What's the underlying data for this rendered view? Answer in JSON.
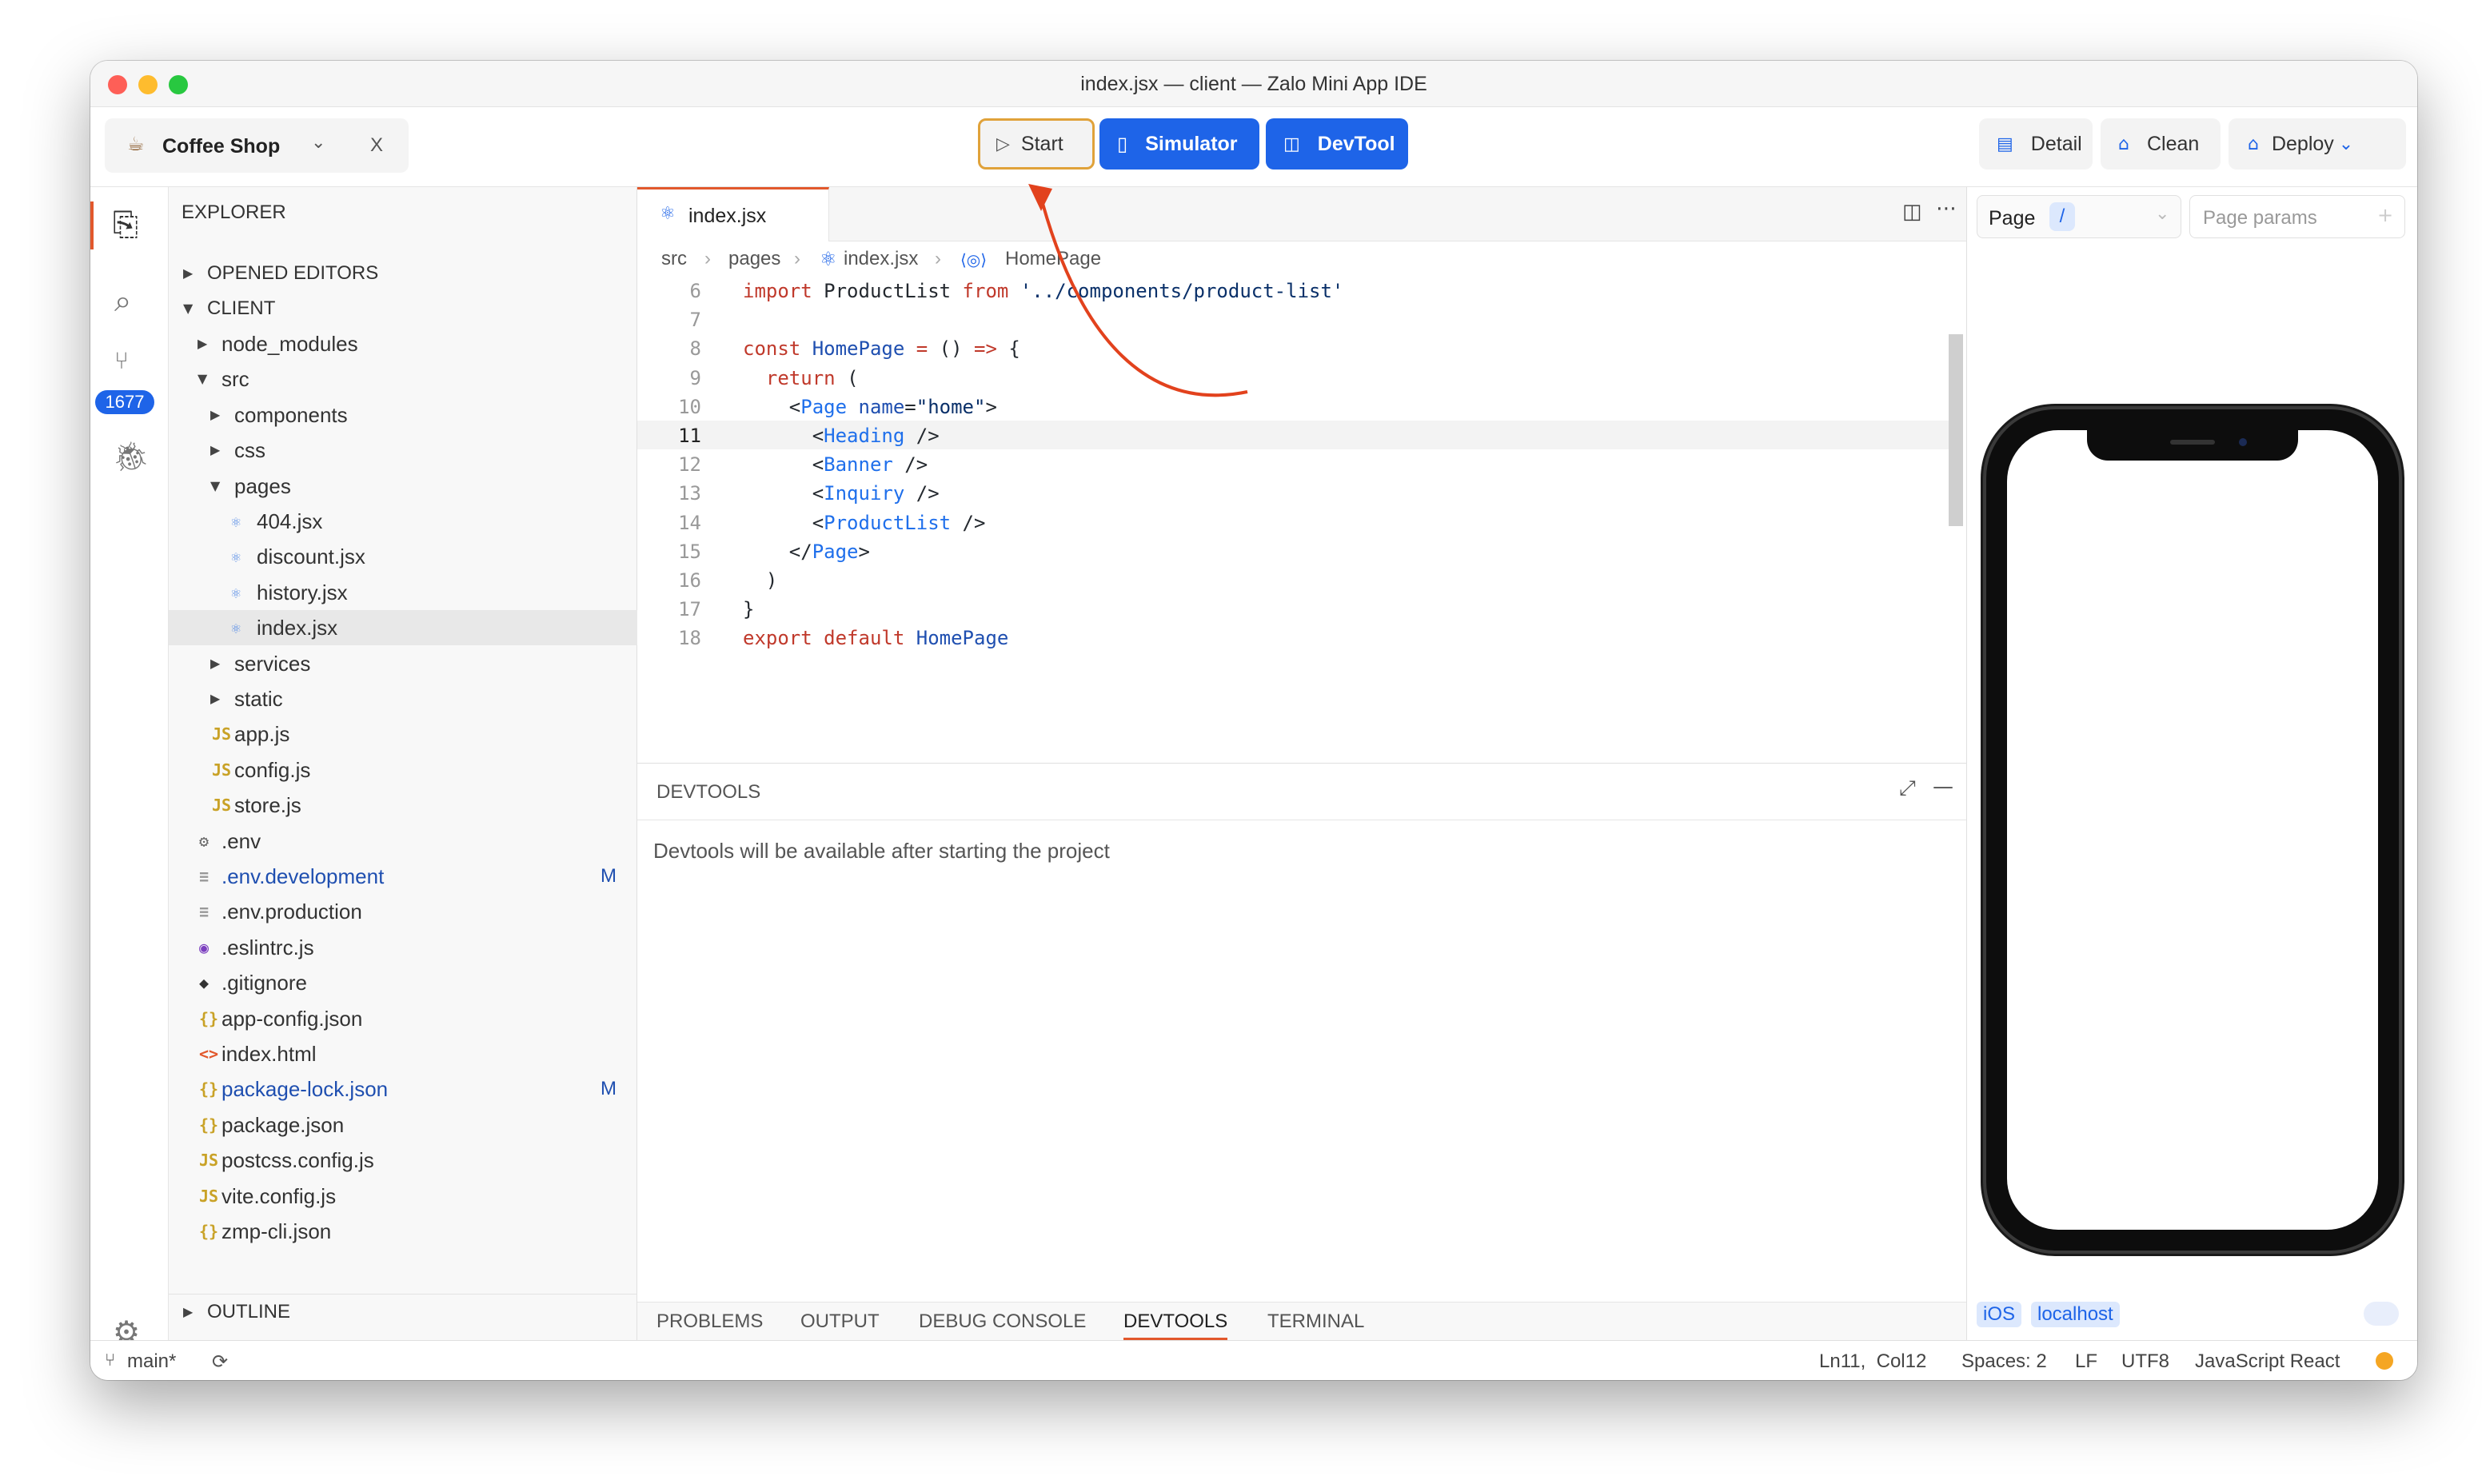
{
  "window": {
    "title": "index.jsx — client — Zalo Mini App IDE",
    "traffic_lights": {
      "close": "#fe5f57",
      "minimize": "#febc2e",
      "zoom": "#28c840"
    }
  },
  "toolbar": {
    "project_name": "Coffee Shop",
    "close_label": "X",
    "start_label": "Start",
    "simulator_label": "Simulator",
    "devtool_label": "DevTool",
    "detail_label": "Detail",
    "clean_label": "Clean",
    "deploy_label": "Deploy",
    "accent_color": "#1e64e8",
    "start_highlight_color": "#e0a23a"
  },
  "activity_bar": {
    "source_control_badge": "1677"
  },
  "explorer": {
    "title": "EXPLORER",
    "opened_editors": "OPENED EDITORS",
    "root": "CLIENT",
    "outline": "OUTLINE",
    "items": [
      {
        "label": "node_modules",
        "kind": "folder",
        "expanded": false,
        "depth": 1
      },
      {
        "label": "src",
        "kind": "folder",
        "expanded": true,
        "depth": 1
      },
      {
        "label": "components",
        "kind": "folder",
        "expanded": false,
        "depth": 2
      },
      {
        "label": "css",
        "kind": "folder",
        "expanded": false,
        "depth": 2
      },
      {
        "label": "pages",
        "kind": "folder",
        "expanded": true,
        "depth": 2
      },
      {
        "label": "404.jsx",
        "kind": "react",
        "depth": 3
      },
      {
        "label": "discount.jsx",
        "kind": "react",
        "depth": 3
      },
      {
        "label": "history.jsx",
        "kind": "react",
        "depth": 3
      },
      {
        "label": "index.jsx",
        "kind": "react",
        "depth": 3,
        "selected": true
      },
      {
        "label": "services",
        "kind": "folder",
        "expanded": false,
        "depth": 2
      },
      {
        "label": "static",
        "kind": "folder",
        "expanded": false,
        "depth": 2
      },
      {
        "label": "app.js",
        "kind": "js",
        "depth": 2
      },
      {
        "label": "config.js",
        "kind": "js",
        "depth": 2
      },
      {
        "label": "store.js",
        "kind": "js",
        "depth": 2
      },
      {
        "label": ".env",
        "kind": "gear",
        "depth": 1
      },
      {
        "label": ".env.development",
        "kind": "text",
        "depth": 1,
        "modified": "M"
      },
      {
        "label": ".env.production",
        "kind": "text",
        "depth": 1
      },
      {
        "label": ".eslintrc.js",
        "kind": "eslint",
        "depth": 1
      },
      {
        "label": ".gitignore",
        "kind": "git",
        "depth": 1
      },
      {
        "label": "app-config.json",
        "kind": "json",
        "depth": 1
      },
      {
        "label": "index.html",
        "kind": "html",
        "depth": 1
      },
      {
        "label": "package-lock.json",
        "kind": "json",
        "depth": 1,
        "modified": "M"
      },
      {
        "label": "package.json",
        "kind": "json",
        "depth": 1
      },
      {
        "label": "postcss.config.js",
        "kind": "js",
        "depth": 1
      },
      {
        "label": "vite.config.js",
        "kind": "js",
        "depth": 1
      },
      {
        "label": "zmp-cli.json",
        "kind": "json",
        "depth": 1
      }
    ]
  },
  "editor": {
    "tab": "index.jsx",
    "breadcrumb": [
      "src",
      "pages",
      "index.jsx",
      "HomePage"
    ],
    "current_line": "11",
    "lines": [
      {
        "n": "6",
        "code": [
          [
            "k",
            "import "
          ],
          [
            "p",
            "ProductList "
          ],
          [
            "k",
            "from "
          ],
          [
            "s",
            "'../components/product-list'"
          ]
        ]
      },
      {
        "n": "7",
        "code": []
      },
      {
        "n": "8",
        "code": [
          [
            "k",
            "const "
          ],
          [
            "f",
            "HomePage "
          ],
          [
            "k",
            "= "
          ],
          [
            "p",
            "() "
          ],
          [
            "k",
            "=> "
          ],
          [
            "p",
            "{"
          ]
        ]
      },
      {
        "n": "9",
        "code": [
          [
            "p",
            "  "
          ],
          [
            "k",
            "return "
          ],
          [
            "p",
            "("
          ]
        ]
      },
      {
        "n": "10",
        "code": [
          [
            "p",
            "    <"
          ],
          [
            "t",
            "Page "
          ],
          [
            "f",
            "name"
          ],
          [
            "p",
            "="
          ],
          [
            "s",
            "\"home\""
          ],
          [
            "p",
            ">"
          ]
        ]
      },
      {
        "n": "11",
        "code": [
          [
            "p",
            "      <"
          ],
          [
            "t",
            "Heading"
          ],
          [
            "p",
            " />"
          ]
        ]
      },
      {
        "n": "12",
        "code": [
          [
            "p",
            "      <"
          ],
          [
            "t",
            "Banner"
          ],
          [
            "p",
            " />"
          ]
        ]
      },
      {
        "n": "13",
        "code": [
          [
            "p",
            "      <"
          ],
          [
            "t",
            "Inquiry"
          ],
          [
            "p",
            " />"
          ]
        ]
      },
      {
        "n": "14",
        "code": [
          [
            "p",
            "      <"
          ],
          [
            "t",
            "ProductList"
          ],
          [
            "p",
            " />"
          ]
        ]
      },
      {
        "n": "15",
        "code": [
          [
            "p",
            "    </"
          ],
          [
            "t",
            "Page"
          ],
          [
            "p",
            ">"
          ]
        ]
      },
      {
        "n": "16",
        "code": [
          [
            "p",
            "  )"
          ]
        ]
      },
      {
        "n": "17",
        "code": [
          [
            "p",
            "}"
          ]
        ]
      },
      {
        "n": "18",
        "code": [
          [
            "k",
            "export default "
          ],
          [
            "f",
            "HomePage"
          ]
        ]
      }
    ]
  },
  "devtools": {
    "title": "DEVTOOLS",
    "message": "Devtools will be available after starting the project",
    "tabs": [
      "PROBLEMS",
      "OUTPUT",
      "DEBUG CONSOLE",
      "DEVTOOLS",
      "TERMINAL"
    ],
    "active_tab": "DEVTOOLS"
  },
  "simulator": {
    "page_label": "Page",
    "page_value": "/",
    "params_placeholder": "Page params",
    "platform_badge": "iOS",
    "host_badge": "localhost"
  },
  "status": {
    "branch": "main*",
    "position": "Ln11,  Col12",
    "spaces": "Spaces: 2",
    "eol": "LF",
    "encoding": "UTF8",
    "language": "JavaScript React"
  }
}
